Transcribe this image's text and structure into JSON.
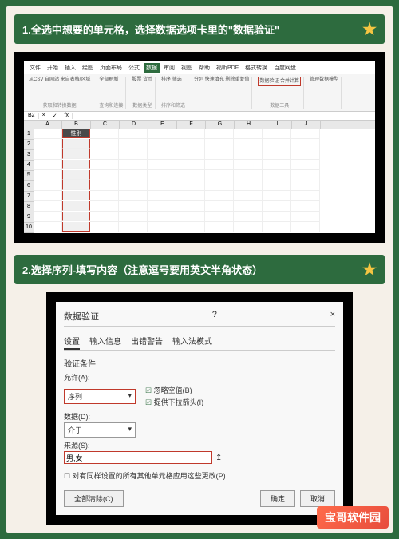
{
  "step1": {
    "title": "1.全选中想要的单元格，选择数据选项卡里的\"数据验证\"",
    "tabs": [
      "文件",
      "开始",
      "插入",
      "绘图",
      "页面布局",
      "公式",
      "数据",
      "审阅",
      "视图",
      "帮助",
      "福昕PDF",
      "格式转换",
      "百度网盘"
    ],
    "activeTab": "数据",
    "ribbonGroups": [
      {
        "items": "从CSV\n自网站\n来自表格/区域",
        "label": "获取和转换数据"
      },
      {
        "items": "全部刷新",
        "label": "查询和连接"
      },
      {
        "items": "股票 货币",
        "label": "数据类型"
      },
      {
        "items": "排序 筛选",
        "label": "排序和筛选"
      },
      {
        "items": "分列 快速填充\n删除重复值",
        "label": ""
      },
      {
        "items": "数据验证\n合并计算",
        "label": "数据工具",
        "highlight": true
      },
      {
        "items": "管理数据模型",
        "label": ""
      }
    ],
    "formulaBar": {
      "cell": "B2",
      "fx": "fx"
    },
    "cols": [
      "A",
      "B",
      "C",
      "D",
      "E",
      "F",
      "G",
      "H",
      "I",
      "J"
    ],
    "rows": [
      "1",
      "2",
      "3",
      "4",
      "5",
      "6",
      "7",
      "8",
      "9",
      "10"
    ],
    "headerCell": "性别"
  },
  "step2": {
    "title": "2.选择序列-填写内容（注意逗号要用英文半角状态）",
    "dialogTitle": "数据验证",
    "close": "×",
    "dlgTabs": [
      "设置",
      "输入信息",
      "出错警告",
      "输入法模式"
    ],
    "sectionTitle": "验证条件",
    "allowLabel": "允许(A):",
    "allowValue": "序列",
    "dataLabel": "数据(D):",
    "dataValue": "介于",
    "chk1": "忽略空值(B)",
    "chk2": "提供下拉箭头(I)",
    "sourceLabel": "来源(S):",
    "sourceValue": "男,女",
    "note": "对有同样设置的所有其他单元格应用这些更改(P)",
    "clearBtn": "全部清除(C)",
    "okBtn": "确定",
    "cancelBtn": "取消"
  },
  "watermark": "宝哥软件园"
}
